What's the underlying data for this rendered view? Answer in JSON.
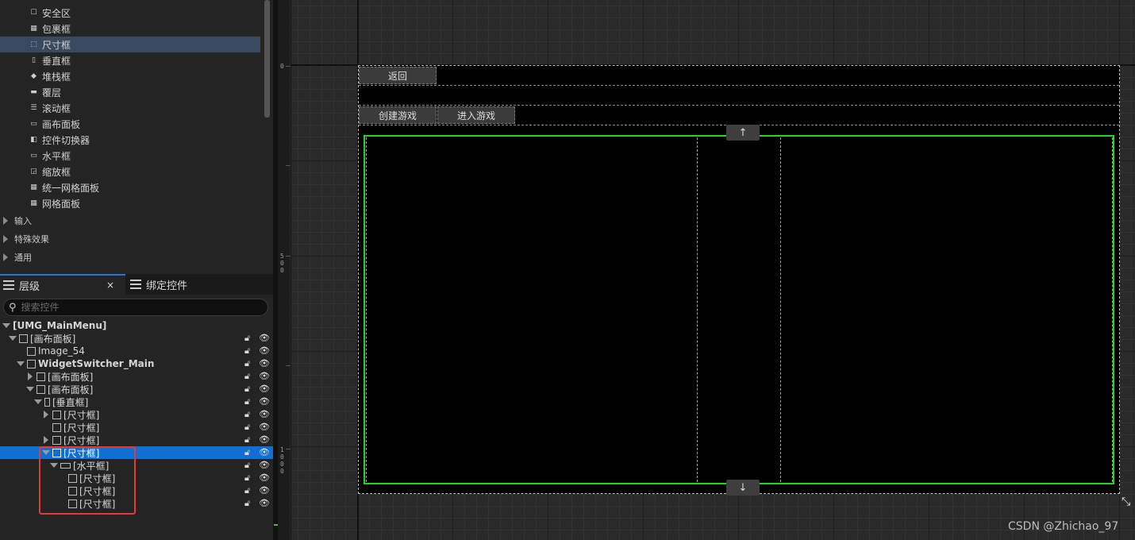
{
  "palette": {
    "items": [
      {
        "label": "安全区",
        "icon": "safe-zone-icon"
      },
      {
        "label": "包裹框",
        "icon": "wrap-box-icon"
      },
      {
        "label": "尺寸框",
        "icon": "size-box-icon",
        "selected": true
      },
      {
        "label": "垂直框",
        "icon": "vertical-box-icon"
      },
      {
        "label": "堆栈框",
        "icon": "stack-box-icon"
      },
      {
        "label": "覆层",
        "icon": "overlay-icon"
      },
      {
        "label": "滚动框",
        "icon": "scroll-box-icon"
      },
      {
        "label": "画布面板",
        "icon": "canvas-panel-icon"
      },
      {
        "label": "控件切换器",
        "icon": "widget-switcher-icon"
      },
      {
        "label": "水平框",
        "icon": "horizontal-box-icon"
      },
      {
        "label": "缩放框",
        "icon": "scale-box-icon"
      },
      {
        "label": "统一网格面板",
        "icon": "uniform-grid-icon"
      },
      {
        "label": "网格面板",
        "icon": "grid-panel-icon"
      }
    ],
    "categories": [
      "输入",
      "特殊效果",
      "通用"
    ]
  },
  "tabs": {
    "hierarchy": "层级",
    "close": "×",
    "bind_widgets": "绑定控件"
  },
  "search": {
    "placeholder": "搜索控件"
  },
  "tree": [
    {
      "label": "[UMG_MainMenu]",
      "bold": true
    },
    {
      "label": "[画布面板]"
    },
    {
      "label": "Image_54"
    },
    {
      "label": "WidgetSwitcher_Main",
      "bold": true
    },
    {
      "label": "[画布面板]"
    },
    {
      "label": "[画布面板]"
    },
    {
      "label": "[垂直框]"
    },
    {
      "label": "[尺寸框]"
    },
    {
      "label": "[尺寸框]"
    },
    {
      "label": "[尺寸框]"
    },
    {
      "label": "[尺寸框]",
      "selected": true
    },
    {
      "label": "[水平框]"
    },
    {
      "label": "[尺寸框]"
    },
    {
      "label": "[尺寸框]"
    },
    {
      "label": "[尺寸框]"
    }
  ],
  "ruler": {
    "labels": [
      "0",
      "5\n0\n0",
      "1\n0\n0\n0"
    ]
  },
  "canvas": {
    "back_button": "返回",
    "create_game_button": "创建游戏",
    "enter_game_button": "进入游戏",
    "scroll_up": "↑",
    "scroll_down": "↓",
    "scroll_highlight_color": "#24d424"
  },
  "watermark": "CSDN @Zhichao_97"
}
